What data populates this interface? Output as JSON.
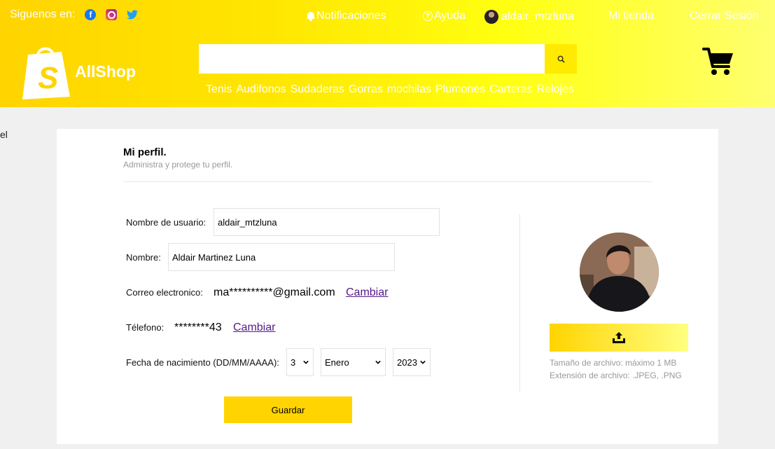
{
  "topbar": {
    "follow_label": "Siguenos en:",
    "notifications": "Notificaciones",
    "help": "Ayuda",
    "username": "aldair_mtzluna",
    "my_store": "Mi tienda",
    "logout": "Cerrar Sesión"
  },
  "brand": {
    "name": "AllShop",
    "logo_letter": "S"
  },
  "search": {
    "value": "",
    "placeholder": ""
  },
  "categories": [
    "Tenis",
    "Audifonos",
    "Sudaderas",
    "Gorras",
    "mochilas",
    "Plumones",
    "Carteras",
    "Relojes"
  ],
  "edge_text": "el",
  "profile": {
    "title": "Mi perfil.",
    "subtitle": "Administra y protege tu perfil.",
    "username_label": "Nombre de usuario:",
    "username_value": "aldair_mtzluna",
    "name_label": "Nombre:",
    "name_value": "Aldair Martinez Luna",
    "email_label": "Correo electronico:",
    "email_value": "ma**********@gmail.com",
    "email_change": "Cambiar",
    "phone_label": "Télefono:",
    "phone_value": "********43",
    "phone_change": "Cambiar",
    "birth_label": "Fecha de nacimiento (DD/MM/AAAA):",
    "birth_day": "3",
    "birth_month": "Enero",
    "birth_year": "2023",
    "save_button": "Guardar",
    "file_size_note": "Tamaño de archivo: máximo 1 MB",
    "file_ext_note": "Extensión de archivo: .JPEG, .PNG"
  },
  "colors": {
    "accent": "#ffd400",
    "link": "#551a8b",
    "background": "#f0f0f0"
  }
}
